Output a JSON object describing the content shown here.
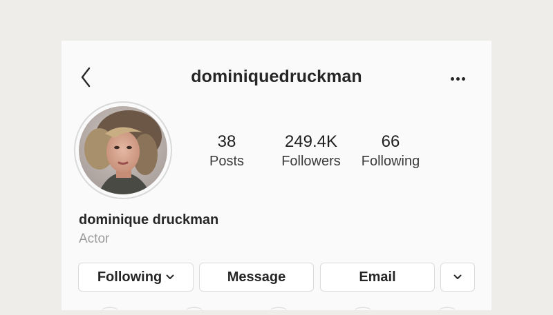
{
  "header": {
    "username": "dominiquedruckman",
    "back_icon": "chevron-left-icon",
    "more_icon": "ellipsis-icon"
  },
  "profile": {
    "stats": [
      {
        "value": "38",
        "label": "Posts"
      },
      {
        "value": "249.4K",
        "label": "Followers"
      },
      {
        "value": "66",
        "label": "Following"
      }
    ],
    "full_name": "dominique druckman",
    "bio": "Actor"
  },
  "actions": {
    "following_label": "Following",
    "message_label": "Message",
    "email_label": "Email",
    "following_icon": "chevron-down-icon",
    "suggest_icon": "chevron-down-icon"
  },
  "colors": {
    "background": "#efedea",
    "card": "#fafafa",
    "text": "#262626",
    "muted": "#9b9b9b",
    "border": "#dbdbdb"
  }
}
